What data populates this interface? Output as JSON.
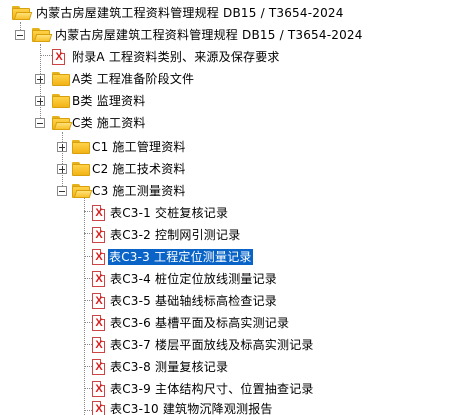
{
  "tree": {
    "root": {
      "label": "内蒙古房屋建筑工程资料管理规程 DB15 / T3654-2024",
      "expanded": true,
      "icon": "folder-open-icon"
    },
    "level1": {
      "label": "内蒙古房屋建筑工程资料管理规程 DB15 / T3654-2024",
      "expanded": true,
      "icon": "folder-open-icon"
    },
    "appendix_a": {
      "label": "附录A  工程资料类别、来源及保存要求",
      "icon": "document-x-icon"
    },
    "class_a": {
      "label": "A类 工程准备阶段文件",
      "expanded": false,
      "icon": "folder-icon"
    },
    "class_b": {
      "label": "B类 监理资料",
      "expanded": false,
      "icon": "folder-icon"
    },
    "class_c": {
      "label": "C类 施工资料",
      "expanded": true,
      "icon": "folder-open-icon"
    },
    "c1": {
      "label": "C1 施工管理资料",
      "expanded": false,
      "icon": "folder-icon"
    },
    "c2": {
      "label": "C2 施工技术资料",
      "expanded": false,
      "icon": "folder-icon"
    },
    "c3": {
      "label": "C3 施工测量资料",
      "expanded": true,
      "icon": "folder-open-icon"
    },
    "c3_items": [
      {
        "label": "表C3-1 交桩复核记录"
      },
      {
        "label": "表C3-2 控制网引测记录"
      },
      {
        "label": "表C3-3 工程定位测量记录",
        "selected": true
      },
      {
        "label": "表C3-4 桩位定位放线测量记录"
      },
      {
        "label": "表C3-5 基础轴线标高检查记录"
      },
      {
        "label": "表C3-6 基槽平面及标高实测记录"
      },
      {
        "label": "表C3-7 楼层平面放线及标高实测记录"
      },
      {
        "label": "表C3-8 测量复核记录"
      },
      {
        "label": "表C3-9 主体结构尺寸、位置抽查记录"
      },
      {
        "label": "表C3-10 建筑物沉降观测报告"
      }
    ]
  },
  "colors": {
    "selection": "#0a64c8",
    "folder": "#f7c12c",
    "doc_mark": "#d61e1e"
  }
}
